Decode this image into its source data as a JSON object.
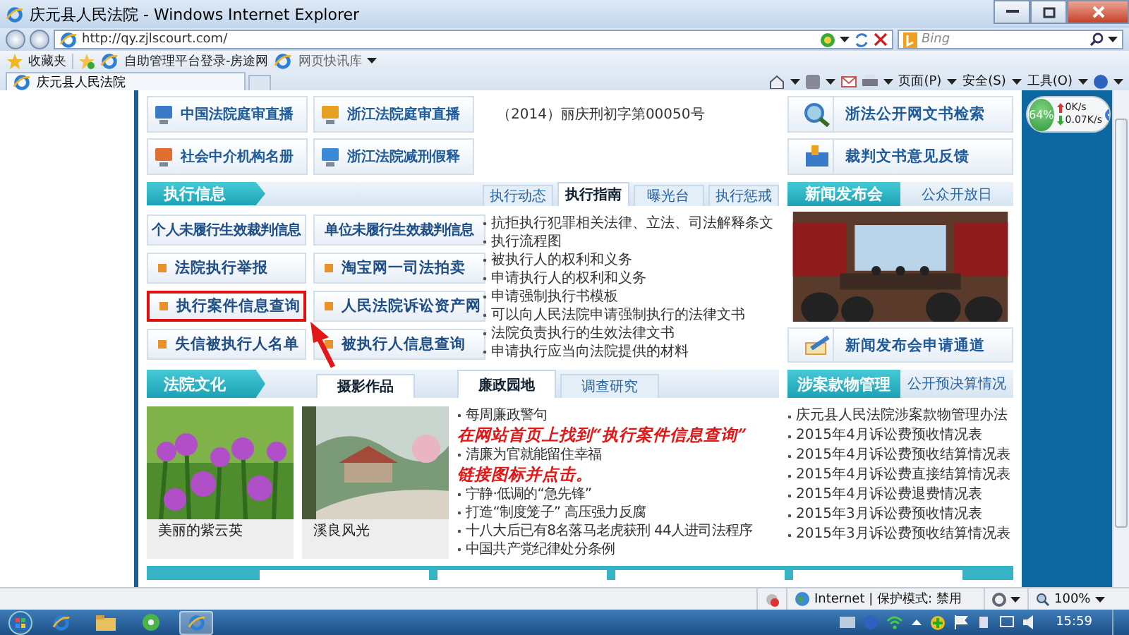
{
  "window": {
    "title": "庆元县人民法院 - Windows Internet Explorer"
  },
  "address_bar": {
    "url": "http://qy.zjlscourt.com/",
    "search_placeholder": "Bing"
  },
  "favorites_bar": {
    "label": "收藏夹",
    "links": [
      "自助管理平台登录-房途网",
      "网页快讯库"
    ]
  },
  "tabs": [
    {
      "label": "庆元县人民法院",
      "selected": true
    }
  ],
  "command_bar": [
    "页面(P)",
    "安全(S)",
    "工具(O)"
  ],
  "page": {
    "quick_links": [
      "中国法院庭审直播",
      "浙江法院庭审直播",
      "社会中介机构名册",
      "浙江法院减刑假释"
    ],
    "notice": "（2014）丽庆刑初字第00050号",
    "right_links": [
      "浙法公开网文书检索",
      "裁判文书意见反馈"
    ],
    "execution": {
      "title": "执行信息",
      "tabs": [
        {
          "label": "执行动态",
          "selected": false
        },
        {
          "label": "执行指南",
          "selected": true
        },
        {
          "label": "曝光台",
          "selected": false
        },
        {
          "label": "执行惩戒",
          "selected": false
        }
      ],
      "buttons": [
        {
          "label": "个人未履行生效裁判信息",
          "kind": "plain",
          "highlighted": false
        },
        {
          "label": "单位未履行生效裁判信息",
          "kind": "plain",
          "highlighted": false
        },
        {
          "label": "法院执行举报",
          "kind": "bullet",
          "highlighted": false
        },
        {
          "label": "淘宝网一司法拍卖",
          "kind": "bullet",
          "highlighted": false
        },
        {
          "label": "执行案件信息查询",
          "kind": "bullet",
          "highlighted": true
        },
        {
          "label": "人民法院诉讼资产网",
          "kind": "bullet",
          "highlighted": false
        },
        {
          "label": "失信被执行人名单",
          "kind": "bullet",
          "highlighted": false
        },
        {
          "label": "被执行人信息查询",
          "kind": "bullet",
          "highlighted": false
        }
      ],
      "items": [
        "抗拒执行犯罪相关法律、立法、司法解释条文",
        "执行流程图",
        "被执行人的权利和义务",
        "申请执行人的权利和义务",
        "申请强制执行书模板",
        "可以向人民法院申请强制执行的法律文书",
        "法院负责执行的生效法律文书",
        "申请执行应当向法院提供的材料"
      ]
    },
    "news": {
      "tabs": [
        {
          "label": "新闻发布会",
          "selected": true
        },
        {
          "label": "公众开放日",
          "selected": false
        }
      ],
      "link": "新闻发布会申请通道"
    },
    "culture": {
      "title": "法院文化",
      "photo_tab": "摄影作品",
      "photos": [
        "美丽的紫云英",
        "溪良风光"
      ],
      "tabs": [
        {
          "label": "廉政园地",
          "selected": true
        },
        {
          "label": "调查研究",
          "selected": false
        }
      ],
      "items": [
        "每周廉政警句",
        "清廉为官就能留住幸福",
        "宁静·低调的“急先锋”",
        "打造“制度笼子” 高压强力反腐",
        "十八大后已有8名落马老虎获刑 44人进司法程序",
        "中国共产党纪律处分条例"
      ]
    },
    "funds": {
      "tabs": [
        {
          "label": "涉案款物管理",
          "selected": true
        },
        {
          "label": "公开预决算情况",
          "selected": false
        }
      ],
      "items": [
        "庆元县人民法院涉案款物管理办法",
        "2015年4月诉讼费预收情况表",
        "2015年4月诉讼费预收结算情况表",
        "2015年4月诉讼费直接结算情况表",
        "2015年4月诉讼费退费情况表",
        "2015年3月诉讼费预收情况表",
        "2015年3月诉讼费预收结算情况表"
      ]
    }
  },
  "annotation": {
    "lines": [
      "在网站首页上找到“执行案件信息查询”",
      "链接图标并点击。"
    ]
  },
  "speed_widget": {
    "percent": "64%",
    "upload": "0K/s",
    "download": "0.07K/s"
  },
  "status_bar": {
    "zone": "Internet | 保护模式: 禁用",
    "zoom": "100%"
  },
  "taskbar": {
    "clock": "15:59"
  }
}
